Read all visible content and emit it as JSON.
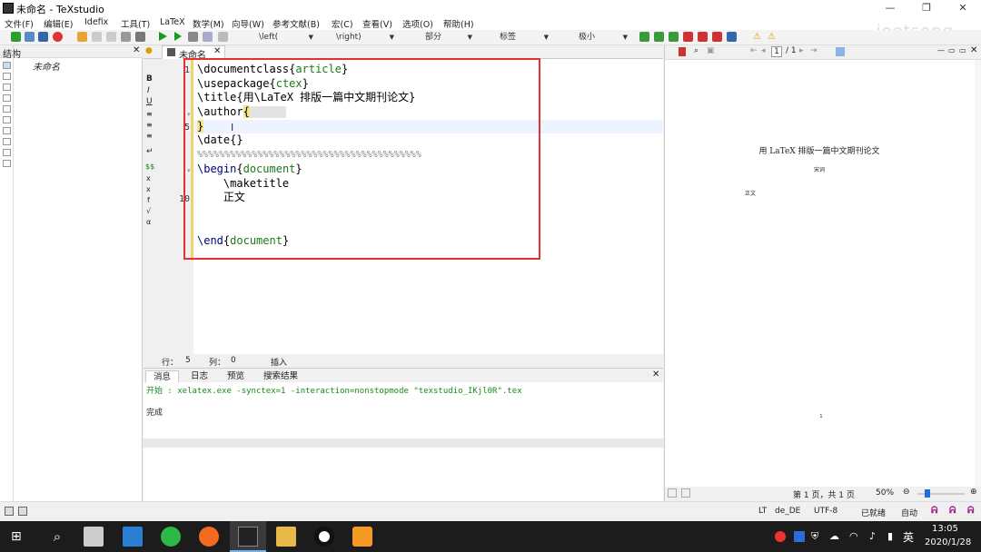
{
  "window": {
    "title": "未命名 - TeXstudio"
  },
  "watermark": "joetsong",
  "menu": [
    "文件(F)",
    "编辑(E)",
    "Idefix",
    "工具(T)",
    "LaTeX",
    "数学(M)",
    "向导(W)",
    "参考文献(B)",
    "宏(C)",
    "查看(V)",
    "选项(O)",
    "帮助(H)"
  ],
  "toolbar": {
    "left_delim": "\\left(",
    "right_delim": "\\right)",
    "section": "部分",
    "label": "标签",
    "size": "极小"
  },
  "structure": {
    "header": "结构",
    "root_item": "未命名"
  },
  "editor": {
    "tab_name": "未命名",
    "line_numbers": [
      "1",
      "5",
      "10"
    ],
    "lines": [
      {
        "cmd": "\\documentclass",
        "arg": "article"
      },
      {
        "cmd": "\\usepackage",
        "arg": "ctex"
      },
      {
        "cmd": "\\title",
        "arg": "用\\LaTeX 排版一篇中文期刊论文"
      },
      {
        "cmd": "\\author",
        "arg": ""
      },
      {
        "text": "}"
      },
      {
        "cmd": "\\date",
        "arg": ""
      },
      {
        "text": "%%%%%%%%%%%%%%%%%%%%%%%%%%%%%%%%%%%%%%%%%"
      },
      {
        "cmd": "\\begin",
        "arg": "document"
      },
      {
        "text": "    \\maketitle"
      },
      {
        "text": "    正文"
      },
      {
        "text": ""
      },
      {
        "text": ""
      },
      {
        "cmd": "\\end",
        "arg": "document"
      }
    ],
    "status": {
      "row_label": "行：",
      "row": "5",
      "col_label": "列：",
      "col": "0",
      "mode": "插入"
    }
  },
  "messages": {
    "tabs": [
      "消息",
      "日志",
      "预览",
      "搜索结果"
    ],
    "command_line": "开始 : xelatex.exe -synctex=1 -interaction=nonstopmode \"texstudio_IKjl0R\".tex",
    "done": "完成"
  },
  "pdf": {
    "page_input": "1",
    "page_total": "/ 1",
    "doc_title": "用 LaTeX 排版一篇中文期刊论文",
    "doc_author": "宋词",
    "doc_body": "正文",
    "page_number": "1",
    "status_page": "第 1 页，共 1 页",
    "zoom": "50%"
  },
  "statusbar": {
    "lang": "de_DE",
    "encoding": "UTF-8",
    "ready": "已就绪",
    "auto": "自动"
  },
  "taskbar": {
    "time": "13:05",
    "date": "2020/1/28",
    "ime": "英"
  },
  "colors": {
    "accent_red": "#e53030",
    "keyword_green": "#1a7a1a"
  }
}
